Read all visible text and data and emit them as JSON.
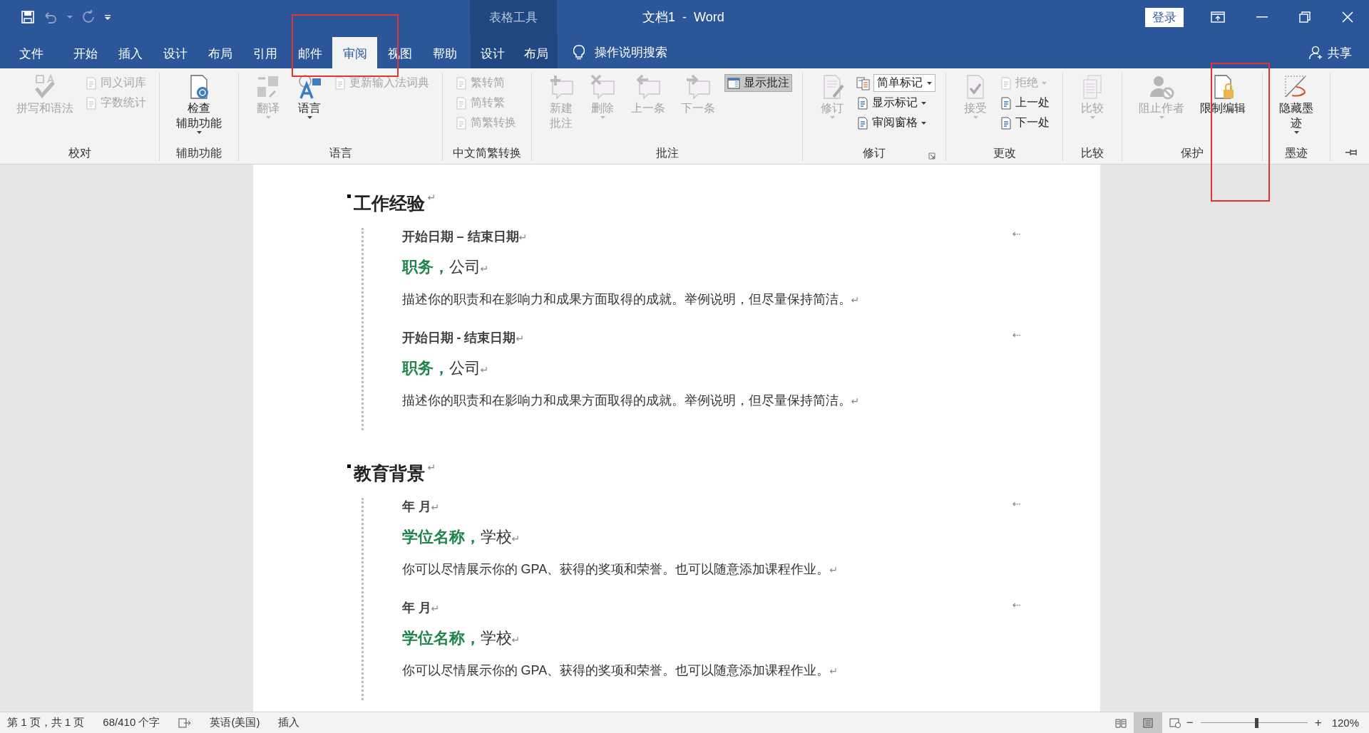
{
  "title_bar": {
    "contextual_label": "表格工具",
    "title": "文档1  -  Word",
    "sign_in": "登录"
  },
  "tabs": [
    {
      "label": "文件",
      "selected": false,
      "contextual": false
    },
    {
      "label": "开始",
      "selected": false,
      "contextual": false
    },
    {
      "label": "插入",
      "selected": false,
      "contextual": false
    },
    {
      "label": "设计",
      "selected": false,
      "contextual": false
    },
    {
      "label": "布局",
      "selected": false,
      "contextual": false
    },
    {
      "label": "引用",
      "selected": false,
      "contextual": false
    },
    {
      "label": "邮件",
      "selected": false,
      "contextual": false
    },
    {
      "label": "审阅",
      "selected": true,
      "contextual": false
    },
    {
      "label": "视图",
      "selected": false,
      "contextual": false
    },
    {
      "label": "帮助",
      "selected": false,
      "contextual": false
    },
    {
      "label": "设计",
      "selected": false,
      "contextual": true
    },
    {
      "label": "布局",
      "selected": false,
      "contextual": true
    }
  ],
  "tell_me": {
    "placeholder": "操作说明搜索"
  },
  "share": "共享",
  "ribbon": [
    {
      "label": "校对",
      "launcher": false,
      "items": [
        {
          "kind": "large",
          "label": "拼写和语法",
          "disabled": true,
          "has_menu": false
        },
        {
          "kind": "stack",
          "items": [
            {
              "kind": "small",
              "label": "同义词库",
              "disabled": true,
              "has_menu": false
            },
            {
              "kind": "small",
              "label": "字数统计",
              "disabled": true,
              "has_menu": false
            }
          ]
        }
      ]
    },
    {
      "label": "辅助功能",
      "launcher": false,
      "items": [
        {
          "kind": "large",
          "label_lines": [
            "检查",
            "辅助功能"
          ],
          "disabled": false,
          "has_menu": true
        }
      ]
    },
    {
      "label": "语言",
      "launcher": false,
      "items": [
        {
          "kind": "large",
          "label": "翻译",
          "disabled": true,
          "has_menu": true
        },
        {
          "kind": "large",
          "label": "语言",
          "disabled": false,
          "has_menu": true
        },
        {
          "kind": "stack",
          "items": [
            {
              "kind": "small",
              "label": "更新输入法词典",
              "disabled": true,
              "has_menu": false
            }
          ]
        }
      ]
    },
    {
      "label": "中文简繁转换",
      "launcher": false,
      "items": [
        {
          "kind": "stack",
          "items": [
            {
              "kind": "small",
              "label": "繁转简",
              "disabled": true,
              "has_menu": false
            },
            {
              "kind": "small",
              "label": "简转繁",
              "disabled": true,
              "has_menu": false
            },
            {
              "kind": "small",
              "label": "简繁转换",
              "disabled": true,
              "has_menu": false
            }
          ]
        }
      ]
    },
    {
      "label": "批注",
      "launcher": false,
      "items": [
        {
          "kind": "large",
          "label_lines": [
            "新建",
            "批注"
          ],
          "disabled": true,
          "has_menu": false
        },
        {
          "kind": "large",
          "label": "删除",
          "disabled": true,
          "has_menu": true
        },
        {
          "kind": "large",
          "label": "上一条",
          "disabled": true,
          "has_menu": false
        },
        {
          "kind": "large",
          "label": "下一条",
          "disabled": true,
          "has_menu": false
        },
        {
          "kind": "stack",
          "items": [
            {
              "kind": "toggle",
              "label": "显示批注",
              "disabled": false,
              "on": true
            }
          ]
        }
      ]
    },
    {
      "label": "修订",
      "launcher": true,
      "items": [
        {
          "kind": "large",
          "label": "修订",
          "disabled": true,
          "has_menu": true
        },
        {
          "kind": "stack",
          "items": [
            {
              "kind": "combo",
              "value": "简单标记",
              "disabled": false
            },
            {
              "kind": "small",
              "label": "显示标记",
              "disabled": false,
              "has_menu": true
            },
            {
              "kind": "small",
              "label": "审阅窗格",
              "disabled": false,
              "has_menu": true
            }
          ]
        }
      ]
    },
    {
      "label": "更改",
      "launcher": false,
      "items": [
        {
          "kind": "large",
          "label": "接受",
          "disabled": true,
          "has_menu": true
        },
        {
          "kind": "stack",
          "items": [
            {
              "kind": "small",
              "label": "拒绝",
              "disabled": true,
              "has_menu": true
            },
            {
              "kind": "small",
              "label": "上一处",
              "disabled": false,
              "has_menu": false
            },
            {
              "kind": "small",
              "label": "下一处",
              "disabled": false,
              "has_menu": false
            }
          ]
        }
      ]
    },
    {
      "label": "比较",
      "launcher": false,
      "items": [
        {
          "kind": "large",
          "label": "比较",
          "disabled": true,
          "has_menu": true
        }
      ]
    },
    {
      "label": "保护",
      "launcher": false,
      "items": [
        {
          "kind": "large",
          "label": "阻止作者",
          "disabled": true,
          "has_menu": true
        },
        {
          "kind": "large",
          "label": "限制编辑",
          "disabled": false,
          "has_menu": false
        }
      ]
    },
    {
      "label": "墨迹",
      "launcher": false,
      "items": [
        {
          "kind": "large",
          "label_lines": [
            "隐藏墨",
            "迹"
          ],
          "disabled": false,
          "has_menu": true
        }
      ]
    }
  ],
  "document": {
    "sections": [
      {
        "heading": "工作经验",
        "heading_mark": "↵",
        "entries": [
          {
            "date": "开始日期 – 结束日期",
            "date_mark": "↵",
            "cell_mark": "⇠",
            "title": "职务，",
            "org": "公司",
            "title_mark": "↵",
            "description": "描述你的职责和在影响力和成果方面取得的成就。举例说明，但尽量保持简洁。",
            "description_mark": "↵"
          },
          {
            "date": "开始日期 - 结束日期",
            "date_mark": "↵",
            "cell_mark": "⇠",
            "title": "职务，",
            "org": "公司",
            "title_mark": "↵",
            "description": "描述你的职责和在影响力和成果方面取得的成就。举例说明，但尽量保持简洁。",
            "description_mark": "↵"
          }
        ]
      },
      {
        "heading": "教育背景",
        "heading_mark": "↵",
        "entries": [
          {
            "date": "年 月",
            "date_mark": "↵",
            "cell_mark": "⇠",
            "title": "学位名称，",
            "org": "学校",
            "title_mark": "↵",
            "description": "你可以尽情展示你的 GPA、获得的奖项和荣誉。也可以随意添加课程作业。",
            "description_mark": "↵"
          },
          {
            "date": "年 月",
            "date_mark": "↵",
            "cell_mark": "⇠",
            "title": "学位名称，",
            "org": "学校",
            "title_mark": "↵",
            "description": "你可以尽情展示你的 GPA、获得的奖项和荣誉。也可以随意添加课程作业。",
            "description_mark": "↵"
          }
        ]
      }
    ]
  },
  "status_bar": {
    "page": "第 1 页，共 1 页",
    "words": "68/410 个字",
    "language": "英语(美国)",
    "mode": "插入",
    "views": [
      {
        "selected": false
      },
      {
        "selected": true
      },
      {
        "selected": false
      }
    ],
    "zoom": {
      "minus": "−",
      "plus": "+",
      "level": 0.52,
      "reading": "120%"
    }
  }
}
